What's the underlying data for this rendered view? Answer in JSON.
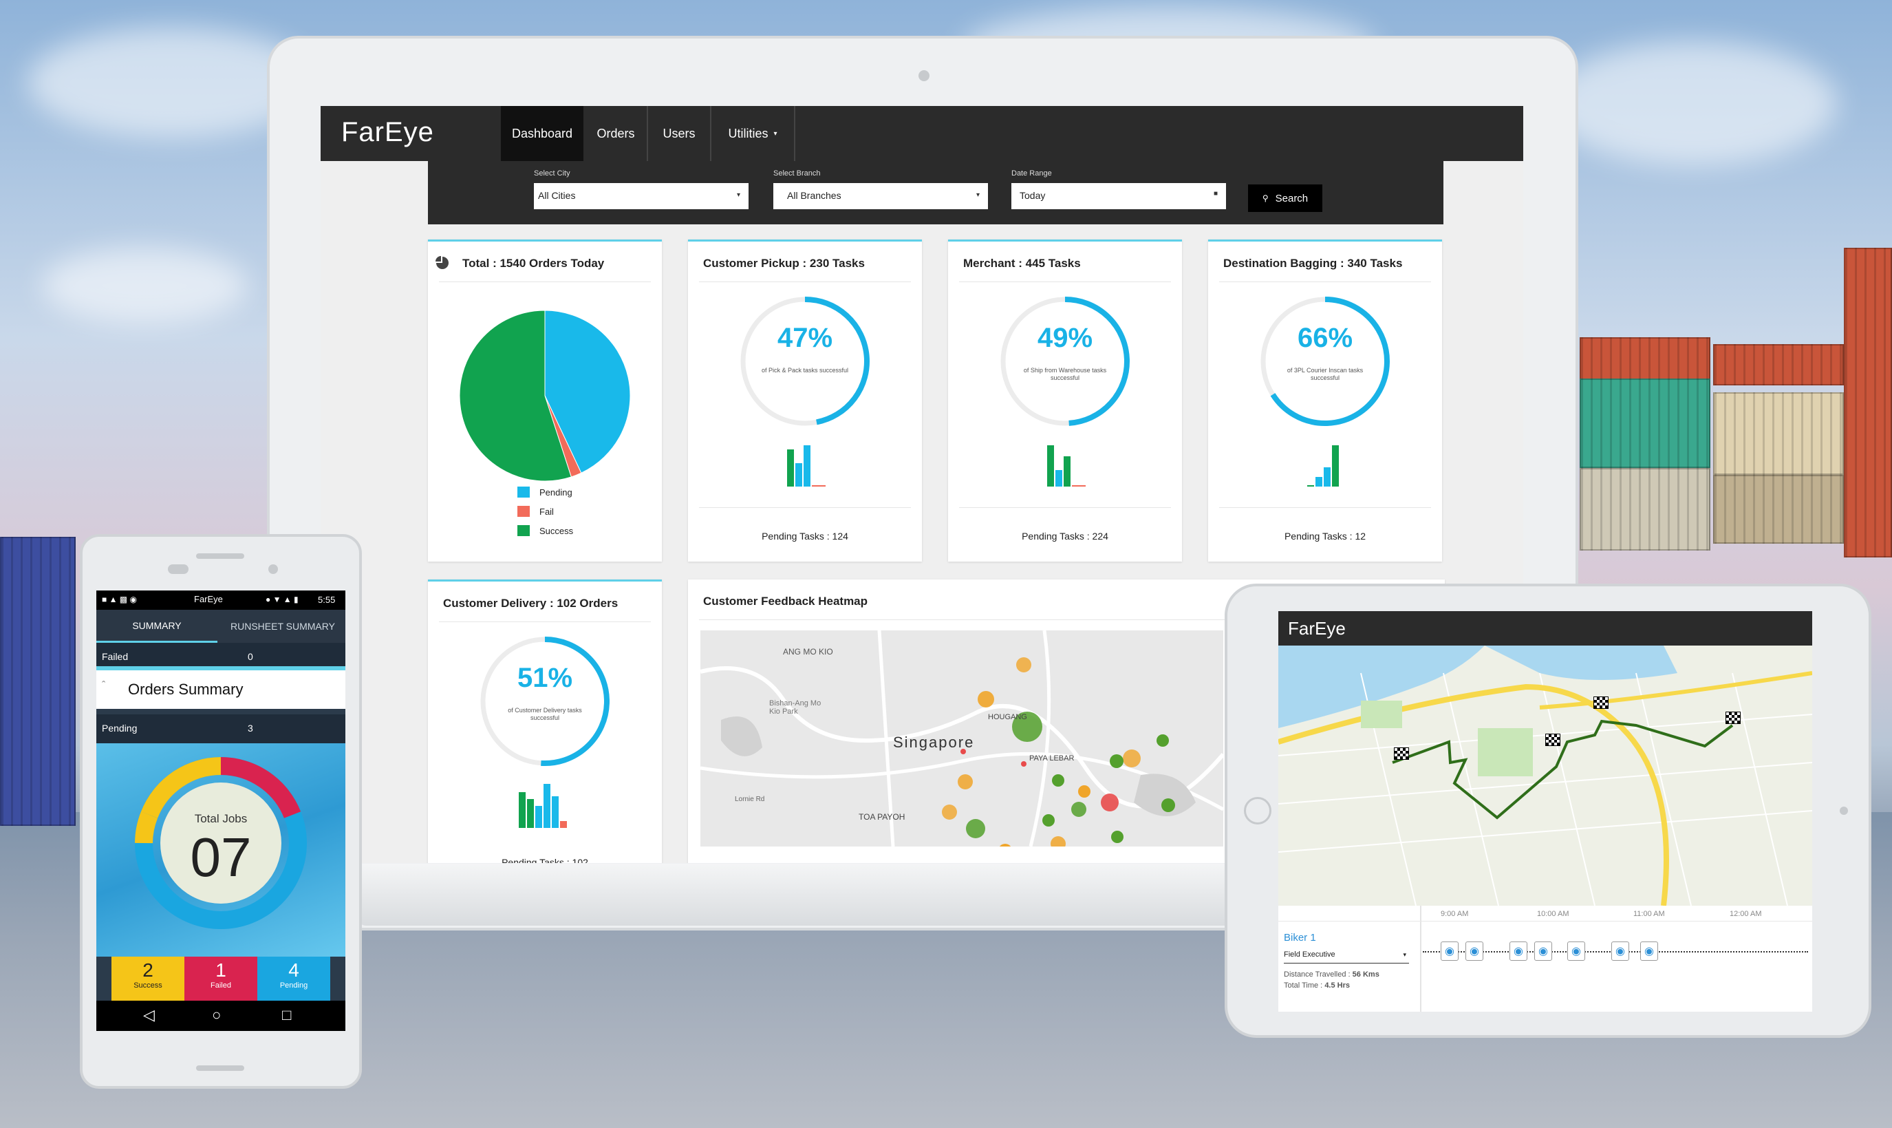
{
  "dashboard": {
    "logo": "FarEye",
    "nav": [
      {
        "label": "Dashboard",
        "active": true
      },
      {
        "label": "Orders",
        "active": false
      },
      {
        "label": "Users",
        "active": false
      },
      {
        "label": "Utilities",
        "active": false
      }
    ],
    "filters": {
      "city_label": "Select City",
      "city_value": "All Cities",
      "branch_label": "Select Branch",
      "branch_value": "All Branches",
      "date_label": "Date Range",
      "date_value": "Today",
      "search_label": "Search"
    },
    "total_card": {
      "title": "Total : 1540 Orders Today",
      "legend": [
        {
          "label": "Pending",
          "color": "#19b9ea"
        },
        {
          "label": "Fail",
          "color": "#f26b5a"
        },
        {
          "label": "Success",
          "color": "#11a34f"
        }
      ]
    },
    "task_cards": [
      {
        "title": "Customer Pickup : 230 Tasks",
        "percent": "47%",
        "fraction": 0.47,
        "sub": "of Pick & Pack tasks successful",
        "pending": "Pending Tasks : 124"
      },
      {
        "title": "Merchant : 445 Tasks",
        "percent": "49%",
        "fraction": 0.49,
        "sub": "of Ship from Warehouse tasks successful",
        "pending": "Pending Tasks : 224"
      },
      {
        "title": "Destination Bagging : 340 Tasks",
        "percent": "66%",
        "fraction": 0.66,
        "sub": "of 3PL Courier Inscan tasks successful",
        "pending": "Pending Tasks : 12"
      }
    ],
    "delivery_card": {
      "title": "Customer Delivery : 102 Orders",
      "percent": "51%",
      "fraction": 0.51,
      "sub": "of Customer Delivery tasks successful",
      "pending": "Pending Tasks : 102"
    },
    "heatmap_card": {
      "title": "Customer Feedback Heatmap",
      "labels": [
        "ANG MO KIO",
        "Bishan-Ang Mo Kio Park",
        "Singapore",
        "HOUGANG",
        "PAYA LEBAR",
        "TOA PAYOH",
        "Lornie Rd"
      ]
    }
  },
  "chart_data": {
    "type": "pie",
    "title": "Total : 1540 Orders Today",
    "categories": [
      "Pending",
      "Fail",
      "Success"
    ],
    "values": [
      0.43,
      0.02,
      0.55
    ]
  },
  "phone": {
    "status_logo": "FarEye",
    "status_time": "5:55",
    "tabs": [
      "SUMMARY",
      "RUNSHEET SUMMARY"
    ],
    "failed_row": {
      "label": "Failed",
      "value": "0"
    },
    "title": "Orders Summary",
    "pending_row": {
      "label": "Pending",
      "value": "3"
    },
    "total_label": "Total Jobs",
    "total_value": "07",
    "tiles": [
      {
        "value": "2",
        "label": "Success",
        "color": "#f5c518"
      },
      {
        "value": "1",
        "label": "Failed",
        "color": "#d9234f"
      },
      {
        "value": "4",
        "label": "Pending",
        "color": "#1aa6e0"
      }
    ]
  },
  "tablet": {
    "logo": "FarEye",
    "rider_name": "Biker 1",
    "role": "Field Executive",
    "distance_label": "Distance Travelled :",
    "distance_value": "56 Kms",
    "time_label": "Total Time :",
    "time_value": "4.5 Hrs",
    "times": [
      "9:00 AM",
      "10:00 AM",
      "11:00 AM",
      "12:00 AM"
    ]
  }
}
